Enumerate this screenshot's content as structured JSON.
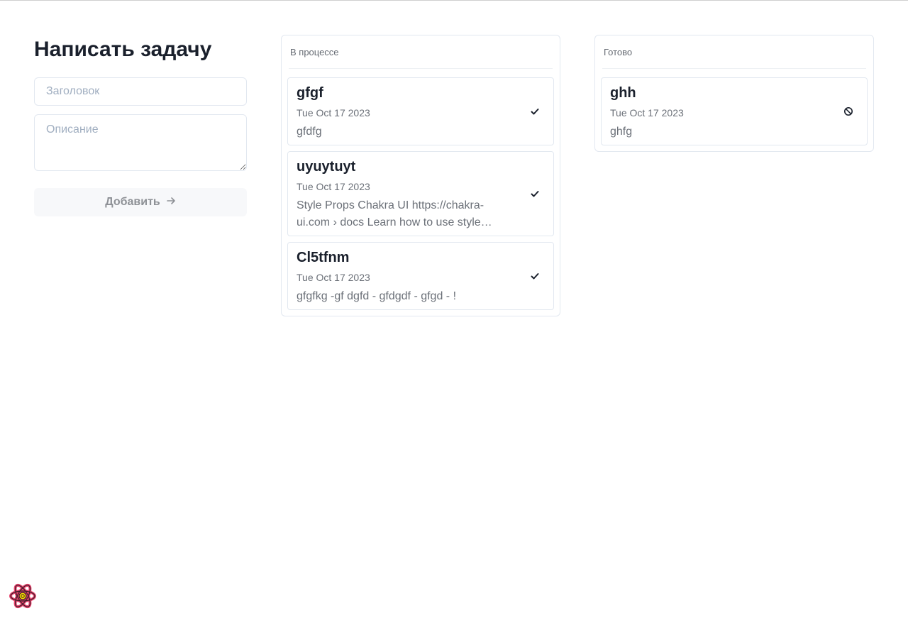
{
  "form": {
    "title": "Написать задачу",
    "title_placeholder": "Заголовок",
    "description_placeholder": "Описание",
    "add_label": "Добавить"
  },
  "columns": {
    "in_progress": {
      "label": "В процессе",
      "cards": [
        {
          "title": "gfgf",
          "date": "Tue Oct 17 2023",
          "description": "gfdfg",
          "action_icon": "check-icon"
        },
        {
          "title": "uyuytuyt",
          "date": "Tue Oct 17 2023",
          "description": "Style Props Chakra UI https://chakra-ui.com › docs Learn how to use style…",
          "action_icon": "check-icon"
        },
        {
          "title": "Cl5tfnm",
          "date": "Tue Oct 17 2023",
          "description": "gfgfkg -gf dgfd - gfdgdf - gfgd - !",
          "action_icon": "check-icon"
        }
      ]
    },
    "done": {
      "label": "Готово",
      "cards": [
        {
          "title": "ghh",
          "date": "Tue Oct 17 2023",
          "description": "ghfg",
          "action_icon": "block-icon"
        }
      ]
    }
  },
  "colors": {
    "text_primary": "#1a202c",
    "text_muted": "#6b7078",
    "border": "#e2e8f0",
    "button_bg": "#f7f8fa",
    "devtools_logo": "#e8426b"
  }
}
